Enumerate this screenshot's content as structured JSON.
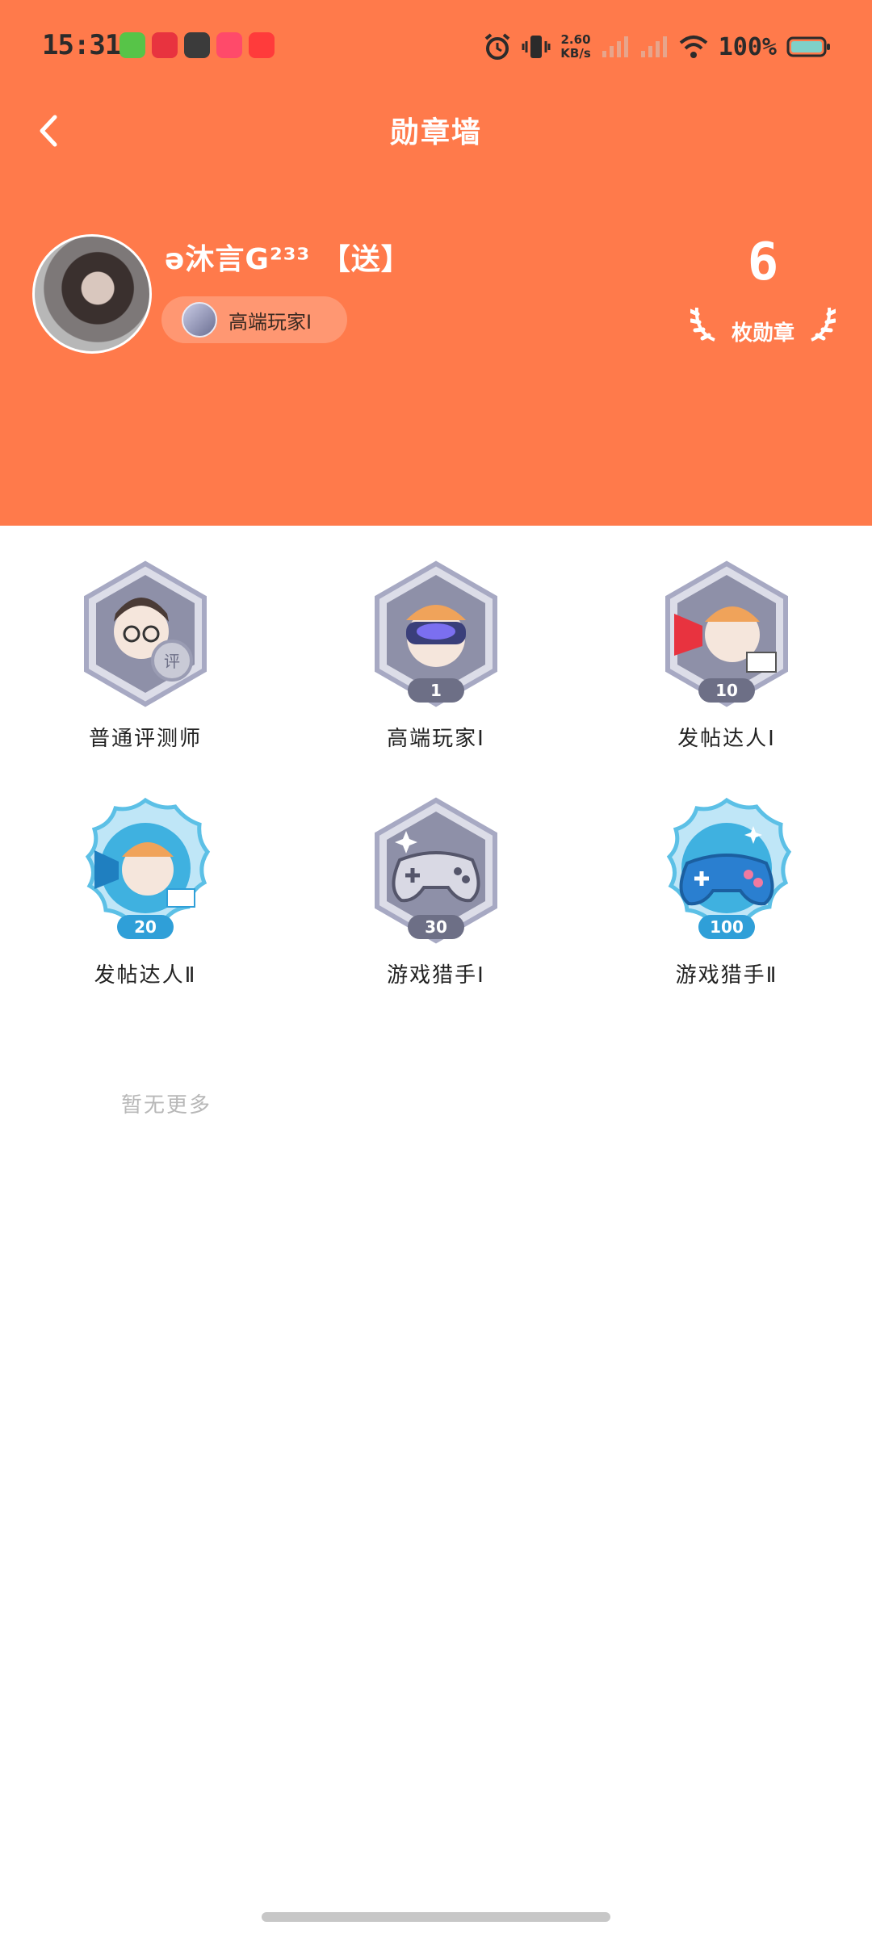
{
  "status_bar": {
    "time": "15:31",
    "net_speed_value": "2.60",
    "net_speed_unit": "KB/s",
    "battery_percent": "100%"
  },
  "nav": {
    "title": "勋章墙",
    "back_icon": "chevron-left-icon"
  },
  "profile": {
    "username": "ə沐言G²³³ 【送】",
    "current_badge_label": "高端玩家Ⅰ",
    "medal_count": "6",
    "medal_count_label": "枚勋章"
  },
  "badges": [
    {
      "name": "普通评测师",
      "level": ""
    },
    {
      "name": "高端玩家Ⅰ",
      "level": "1"
    },
    {
      "name": "发帖达人Ⅰ",
      "level": "10"
    },
    {
      "name": "发帖达人Ⅱ",
      "level": "20"
    },
    {
      "name": "游戏猎手Ⅰ",
      "level": "30"
    },
    {
      "name": "游戏猎手Ⅱ",
      "level": "100"
    }
  ],
  "footer_note": "暂无更多",
  "colors": {
    "header_bg": "#ff7a4b",
    "silver_badge": "#8e90a8",
    "blue_badge": "#2f9fd8"
  }
}
